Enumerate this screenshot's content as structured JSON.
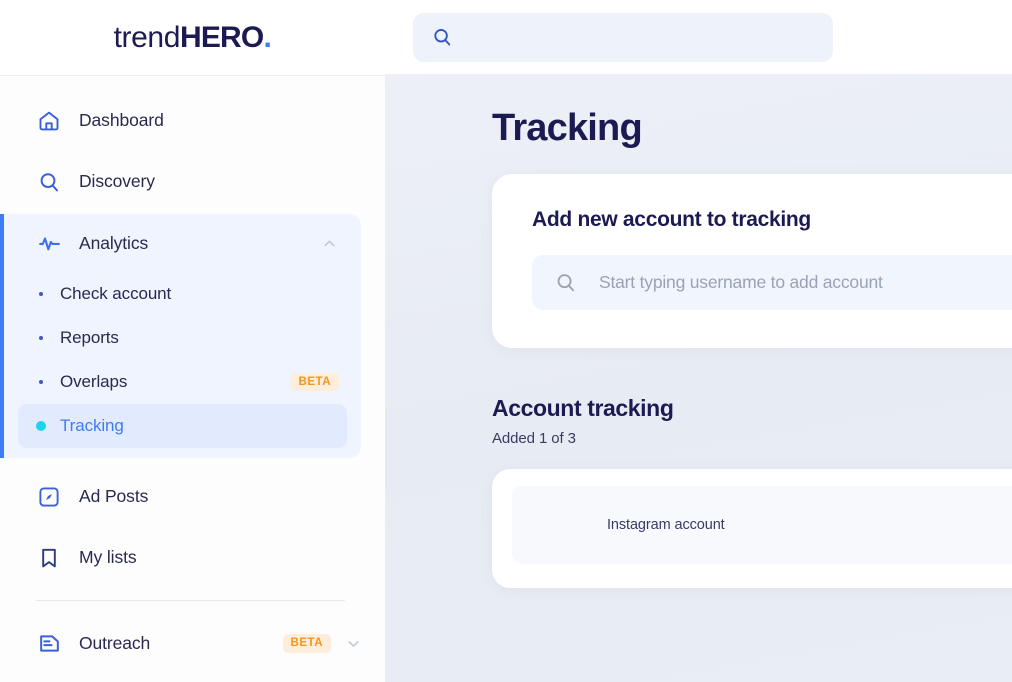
{
  "brand": {
    "logo_regular": "trend",
    "logo_bold": "HERO",
    "logo_dot": "."
  },
  "topbar": {
    "search_placeholder": "",
    "search_value": "",
    "search_icon": "search-icon"
  },
  "sidebar": {
    "items": [
      {
        "label": "Dashboard",
        "icon": "home-icon"
      },
      {
        "label": "Discovery",
        "icon": "search-icon"
      }
    ],
    "group": {
      "label": "Analytics",
      "icon": "activity-pulse-icon",
      "chevron": "chevron-up-icon",
      "children": [
        {
          "label": "Check account",
          "badge": ""
        },
        {
          "label": "Reports",
          "badge": ""
        },
        {
          "label": "Overlaps",
          "badge": "BETA"
        },
        {
          "label": "Tracking",
          "badge": "",
          "active": true
        }
      ]
    },
    "items_after": [
      {
        "label": "Ad Posts",
        "icon": "compass-square-icon"
      },
      {
        "label": "My lists",
        "icon": "bookmark-icon"
      }
    ],
    "outreach": {
      "label": "Outreach",
      "icon": "document-lines-icon",
      "badge": "BETA",
      "chevron": "chevron-down-icon"
    }
  },
  "main": {
    "page_title": "Tracking",
    "add_card": {
      "title": "Add new account to tracking",
      "search_placeholder": "Start typing username to add account",
      "search_value": "",
      "search_icon": "search-icon"
    },
    "tracking_section": {
      "title": "Account tracking",
      "subtitle": "Added 1 of 3",
      "table": {
        "columns": [
          "Instagram account"
        ],
        "rows": []
      }
    }
  },
  "colors": {
    "brand_navy": "#1b1b52",
    "accent_blue": "#3d7cf4",
    "accent_cyan": "#1fd3f0",
    "beta_orange": "#f7941d",
    "beta_bg": "#fdeedc",
    "canvas": "#e8ecf3"
  }
}
